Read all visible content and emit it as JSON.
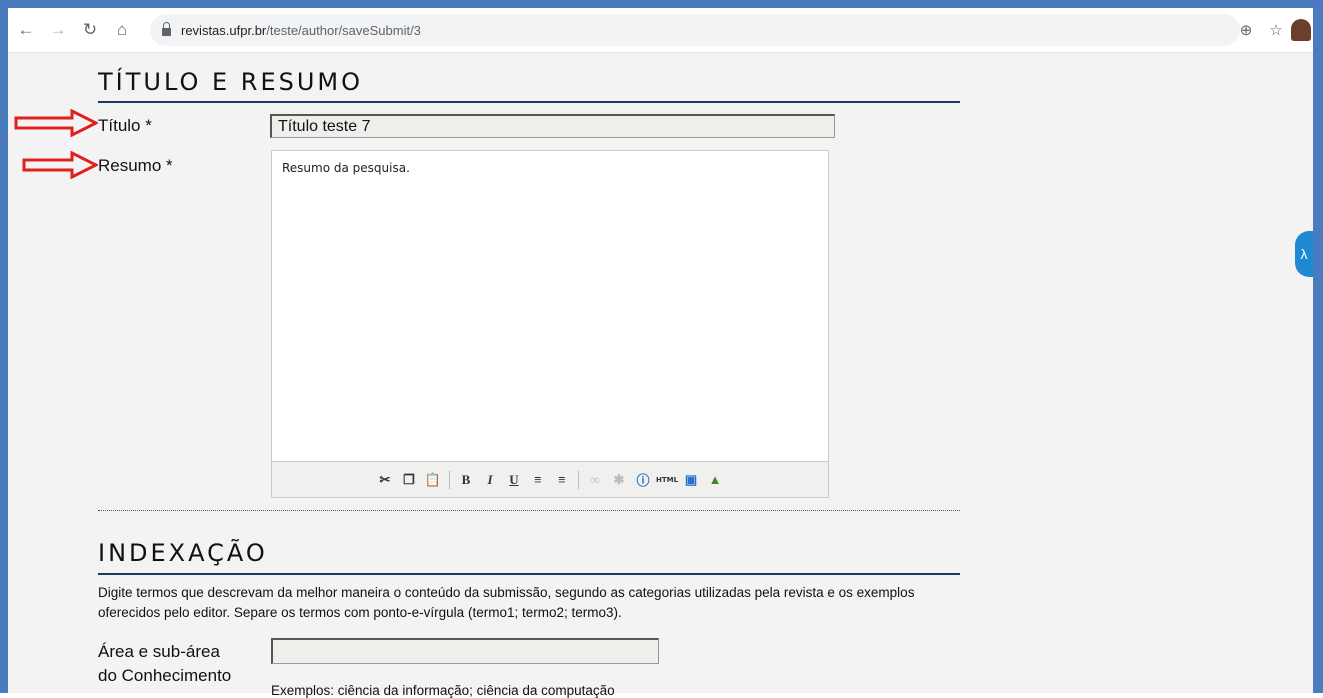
{
  "browser": {
    "url_host": "revistas.ufpr.br",
    "url_path": "/teste/author/saveSubmit/3"
  },
  "icons": {
    "back": "arrow-left-icon",
    "forward": "arrow-right-icon",
    "reload": "reload-icon",
    "home": "home-icon",
    "lock": "lock-icon",
    "zoom": "zoom-icon",
    "bookmark": "star-icon",
    "accessibility": "accessibility-widget-icon"
  },
  "section1": {
    "title": "TÍTULO E RESUMO",
    "title_label": "Título *",
    "title_value": "Título teste 7",
    "abstract_label": "Resumo *",
    "abstract_value": "Resumo da pesquisa."
  },
  "section2": {
    "title": "INDEXAÇÃO",
    "description": "Digite termos que descrevam da melhor maneira o conteúdo da submissão, segundo as categorias utilizadas pela revista e os exemplos oferecidos pelo editor. Separe os termos com ponto-e-vírgula (termo1; termo2; termo3).",
    "area_label_1": "Área e sub-área",
    "area_label_2": "do Conhecimento",
    "area_hint": "Exemplos: ciência da informação; ciência da computação"
  },
  "colors": {
    "frame": "#4a7bbf",
    "rule": "#1f3a5f",
    "arrow": "#e02020",
    "input_bg": "#efeeea"
  }
}
